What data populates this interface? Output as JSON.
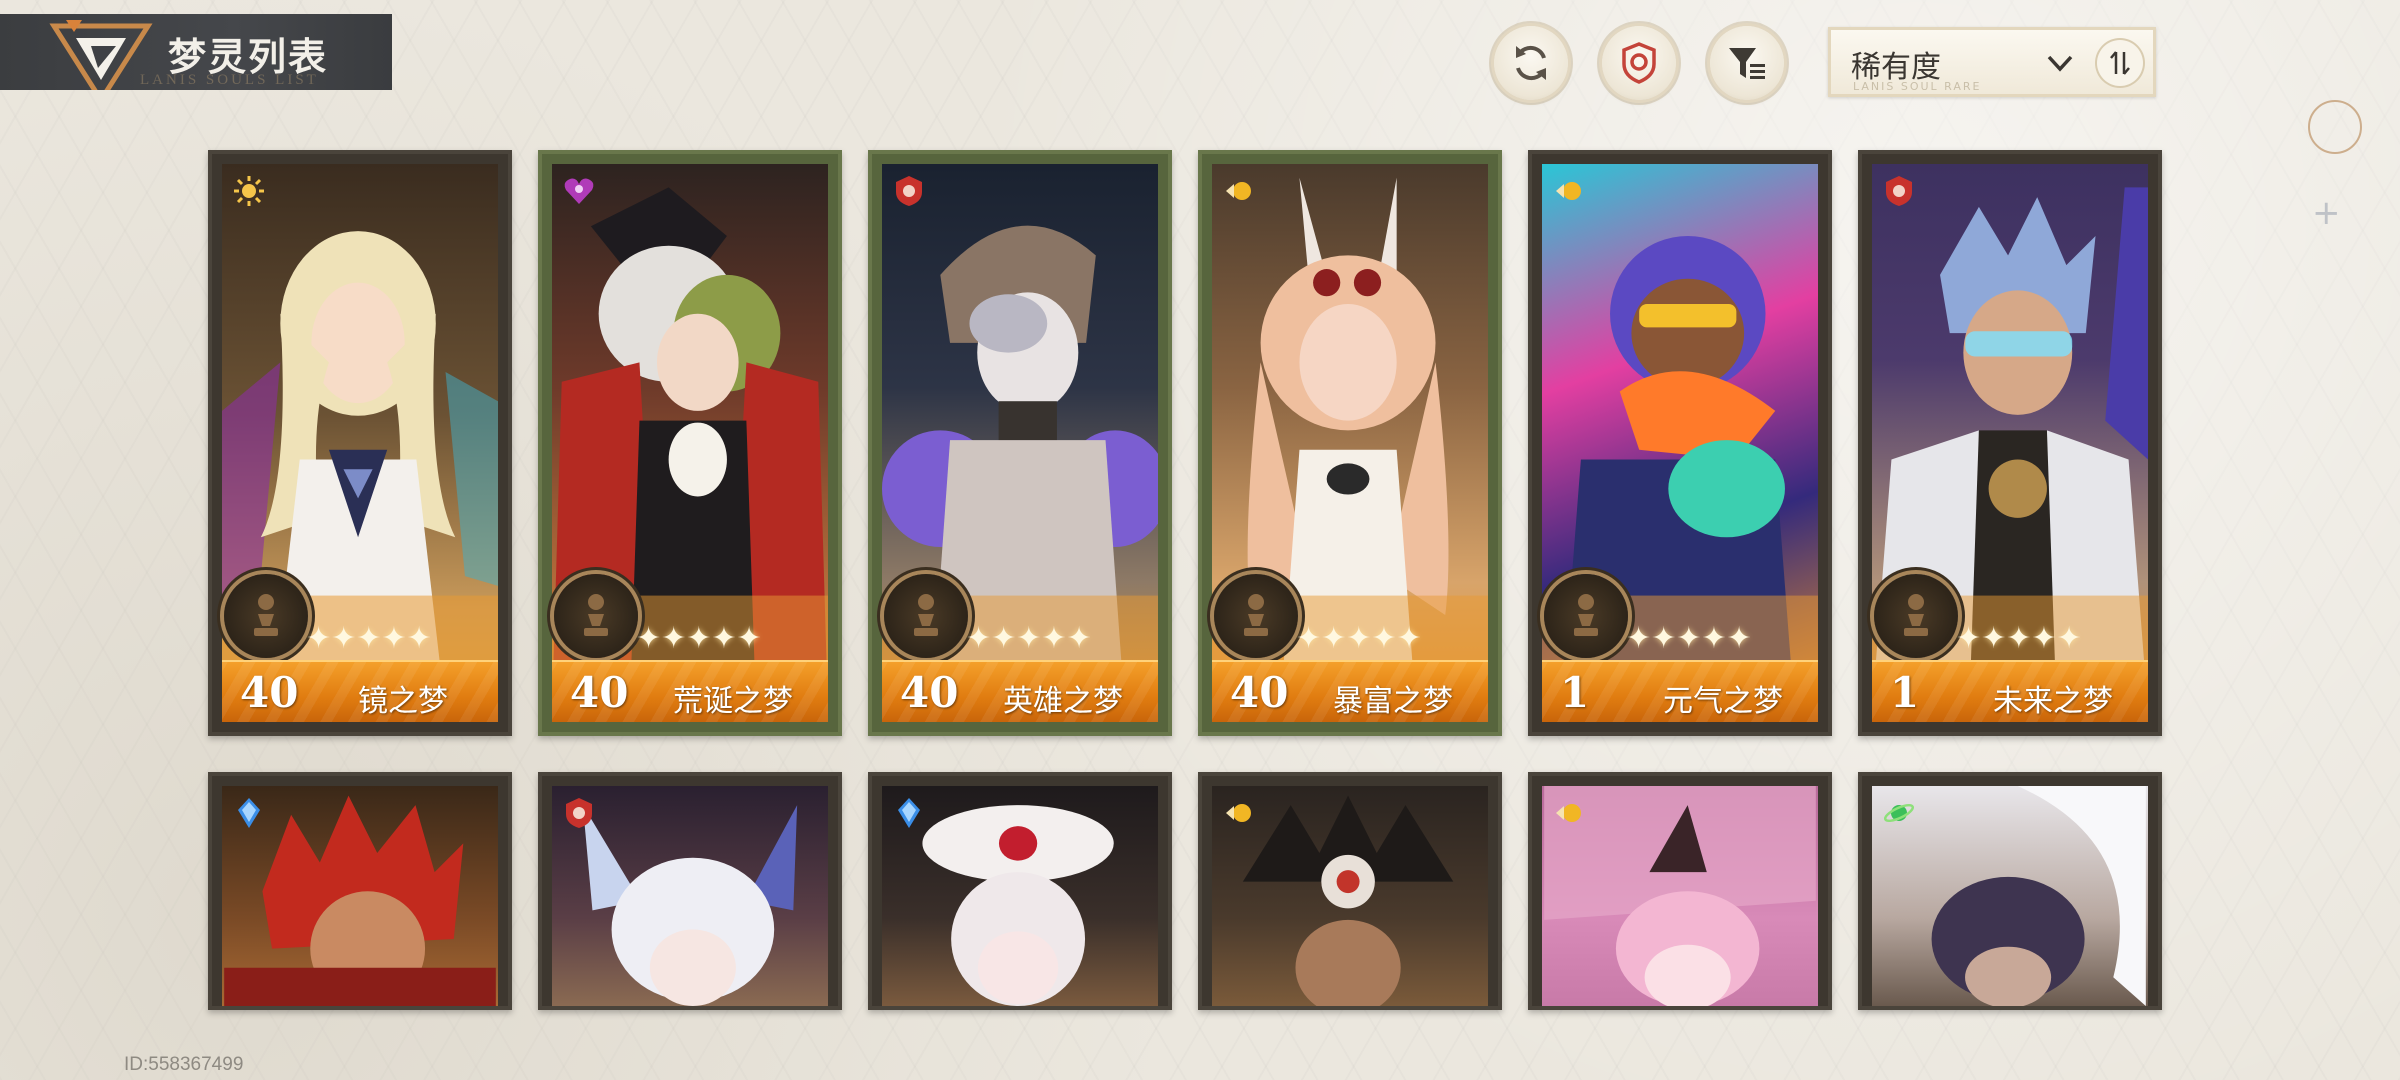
{
  "header": {
    "title": "梦灵列表",
    "title_sub": "LANIS SOULS LIST"
  },
  "toolbar": {
    "refresh_icon": "refresh-icon",
    "badge_icon": "badge-icon",
    "filter_icon": "filter-icon"
  },
  "sort": {
    "label": "稀有度",
    "sub": "LANIS SOUL RARE",
    "chevron_icon": "chevron-down-icon",
    "order_icon": "sort-order-icon"
  },
  "colors": {
    "accent_orange": "#e88a1a",
    "banner_dark": "#3f4145",
    "card_green_border": "#69774b",
    "card_dark_border": "#4a443b",
    "background": "#ebe7de"
  },
  "cards_row1": [
    {
      "level": "40",
      "name": "镜之梦",
      "element": "sun-icon",
      "stars": "✦✦✦✦✦",
      "frame": "dark"
    },
    {
      "level": "40",
      "name": "荒诞之梦",
      "element": "heart-icon",
      "stars": "✦✦✦✦✦",
      "frame": "green"
    },
    {
      "level": "40",
      "name": "英雄之梦",
      "element": "red-shield-icon",
      "stars": "✦✦✦✦✦",
      "frame": "green"
    },
    {
      "level": "40",
      "name": "暴富之梦",
      "element": "gold-orb-icon",
      "stars": "✦✦✦✦✦",
      "frame": "green"
    },
    {
      "level": "1",
      "name": "元气之梦",
      "element": "gold-orb-icon",
      "stars": "✦✦✦✦✦",
      "frame": "dark"
    },
    {
      "level": "1",
      "name": "未来之梦",
      "element": "red-shield-icon",
      "stars": "✦✦✦✦✦",
      "frame": "dark"
    }
  ],
  "cards_row2": [
    {
      "element": "blue-crystal-icon"
    },
    {
      "element": "red-shield-icon"
    },
    {
      "element": "blue-crystal-icon"
    },
    {
      "element": "gold-orb-icon"
    },
    {
      "element": "gold-orb-icon"
    },
    {
      "element": "green-planet-icon"
    }
  ],
  "footer": {
    "player_id": "ID:558367499"
  }
}
